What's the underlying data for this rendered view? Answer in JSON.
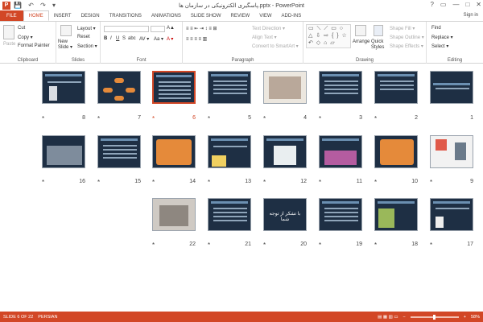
{
  "window": {
    "title": "پاسگیری الکترونیکی در سازمان ها.pptx - PowerPoint",
    "app_icon": "P",
    "quick_access": "💾 ↶ ↷ ▾",
    "controls": [
      "?",
      "▭",
      "—",
      "□",
      "✕"
    ]
  },
  "tabs": [
    "FILE",
    "HOME",
    "INSERT",
    "DESIGN",
    "TRANSITIONS",
    "ANIMATIONS",
    "SLIDE SHOW",
    "REVIEW",
    "VIEW",
    "ADD-INS"
  ],
  "account": {
    "signin": "Sign in"
  },
  "ribbon": {
    "clipboard": {
      "label": "Clipboard",
      "paste": "Paste",
      "cut": "Cut",
      "copy": "Copy ▾",
      "format_painter": "Format Painter"
    },
    "slides": {
      "label": "Slides",
      "new_slide": "New Slide ▾",
      "layout": "Layout ▾",
      "reset": "Reset",
      "section": "Section ▾"
    },
    "font": {
      "label": "Font",
      "bold": "B",
      "italic": "I",
      "underline": "U",
      "strike": "S",
      "shadow": "abc",
      "spacing": "AV ▾",
      "case": "Aa ▾",
      "color": "A ▾",
      "grow": "A▲",
      "shrink": "A▼",
      "clear": "✎"
    },
    "paragraph": {
      "label": "Paragraph",
      "text_direction": "Text Direction ▾",
      "align_text": "Align Text ▾",
      "smartart": "Convert to SmartArt ▾",
      "bullets": "≡ ≡ ⇤ ⇥ ↕ ≡ ⊞",
      "align": "≡ ≡ ≡ ≡ ▥"
    },
    "drawing": {
      "label": "Drawing",
      "shapes": "▭ ⟍ ⟋ ▭ ○ △ ⇩ ⇨ { } ☆ ↶ ◇ ⌂ ▱",
      "arrange": "Arrange",
      "quick_styles": "Quick Styles",
      "shape_fill": "Shape Fill ▾",
      "shape_outline": "Shape Outline ▾",
      "shape_effects": "Shape Effects ▾"
    },
    "editing": {
      "label": "Editing",
      "find": "Find",
      "replace": "Replace ▾",
      "select": "Select ▾"
    }
  },
  "slides": [
    {
      "number": "1",
      "transition": ""
    },
    {
      "number": "2",
      "transition": "*"
    },
    {
      "number": "3",
      "transition": "*"
    },
    {
      "number": "4",
      "transition": "*"
    },
    {
      "number": "5",
      "transition": "*"
    },
    {
      "number": "6",
      "transition": "*"
    },
    {
      "number": "7",
      "transition": "*"
    },
    {
      "number": "8",
      "transition": "*"
    },
    {
      "number": "9",
      "transition": "*"
    },
    {
      "number": "10",
      "transition": "*"
    },
    {
      "number": "11",
      "transition": "*"
    },
    {
      "number": "12",
      "transition": "*"
    },
    {
      "number": "13",
      "transition": "*"
    },
    {
      "number": "14",
      "transition": "*"
    },
    {
      "number": "15",
      "transition": "*"
    },
    {
      "number": "16",
      "transition": "*"
    },
    {
      "number": "17",
      "transition": "*"
    },
    {
      "number": "18",
      "transition": "*"
    },
    {
      "number": "19",
      "transition": "*"
    },
    {
      "number": "20",
      "transition": "*"
    },
    {
      "number": "21",
      "transition": "*"
    },
    {
      "number": "22",
      "transition": "*"
    }
  ],
  "selected_slide": "6",
  "slide_text": {
    "s20": "با تشکر از توجه شما"
  },
  "status": {
    "slide_info": "SLIDE 6 OF 22",
    "language": "PERSIAN",
    "icons": "▤ ▦ ▥ ▭",
    "zoom": "58%",
    "zoom_minus": "−",
    "zoom_plus": "+"
  },
  "colors": {
    "accent": "#d24726",
    "slide_bg": "#1e2f44"
  }
}
